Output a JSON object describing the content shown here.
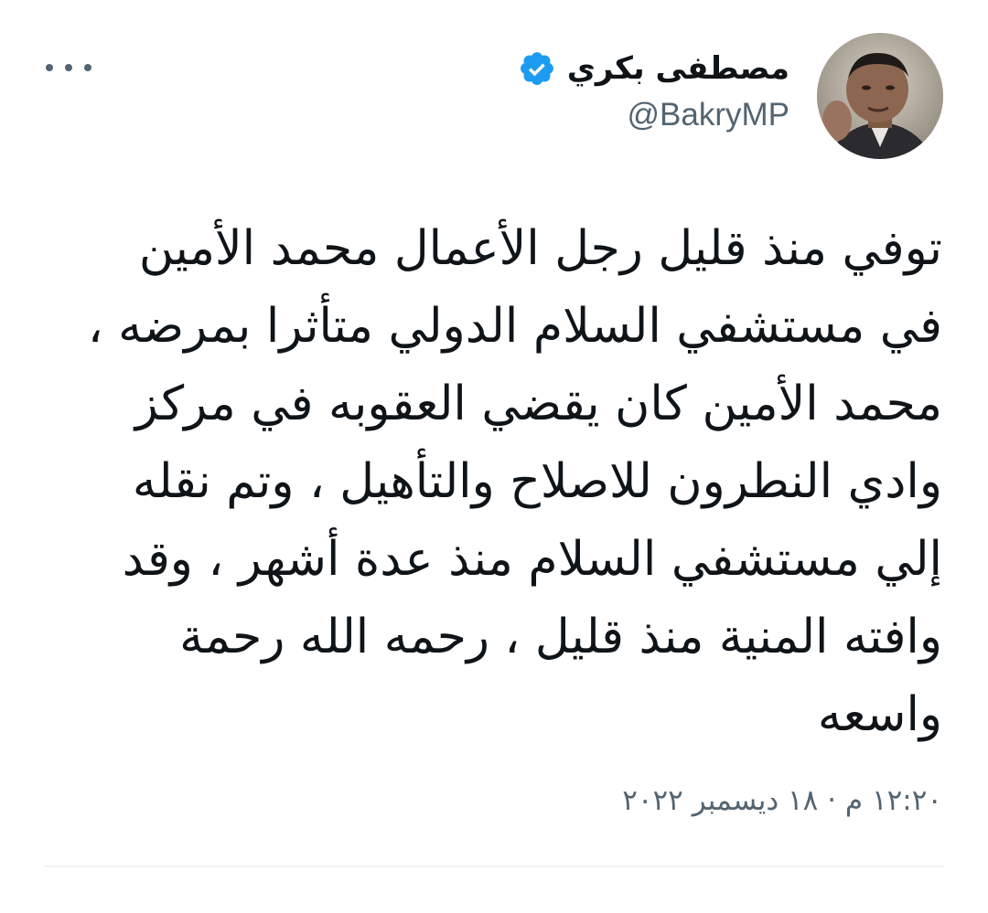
{
  "tweet": {
    "author": {
      "display_name": "مصطفى بكري",
      "handle": "@BakryMP",
      "verified": true,
      "avatar_icon": "profile-photo"
    },
    "more_icon": "more-horizontal-icon",
    "text": "توفي منذ قليل رجل الأعمال محمد الأمين\nفي مستشفي السلام الدولي متأثرا بمرضه ،\nمحمد الأمين كان يقضي العقوبه في مركز\nوادي النطرون للاصلاح والتأهيل ، وتم نقله\nإلي مستشفي السلام منذ عدة أشهر ، وقد\nوافته المنية منذ قليل ، رحمه الله رحمة\nواسعه",
    "timestamp": "١٢:٢٠ م · ١٨ ديسمبر ٢٠٢٢"
  },
  "colors": {
    "text_primary": "#0f1419",
    "text_secondary": "#536471",
    "verified_blue": "#1d9bf0",
    "divider": "#eff3f4"
  }
}
